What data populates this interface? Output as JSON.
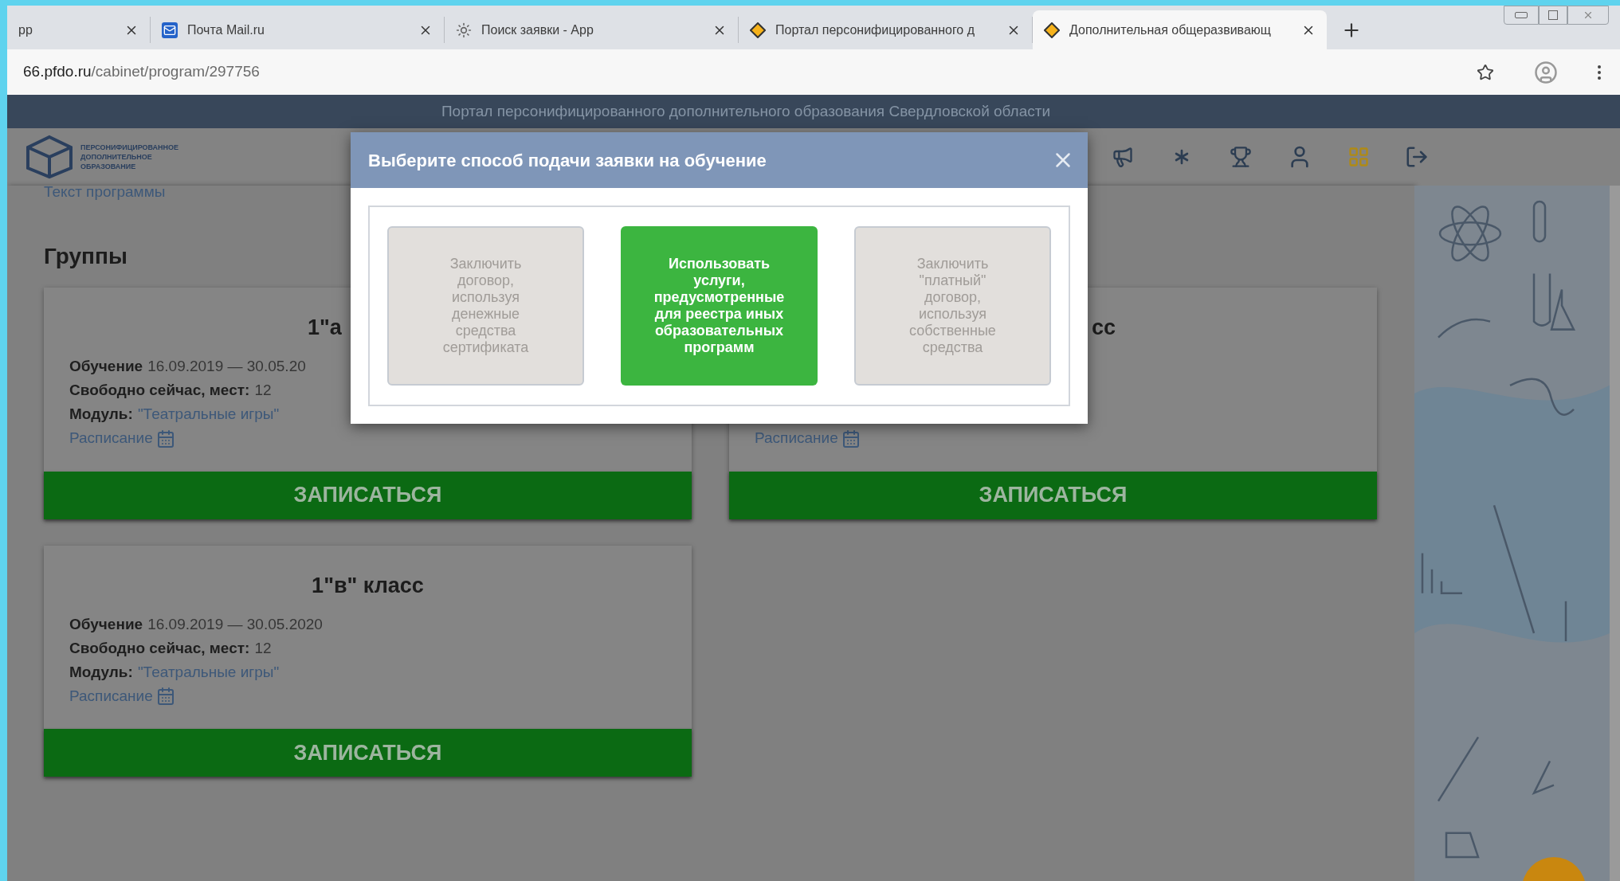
{
  "browser": {
    "tabs": [
      {
        "title": "pp",
        "kind": "plain",
        "selected": false
      },
      {
        "title": "Почта Mail.ru",
        "kind": "mail",
        "selected": false
      },
      {
        "title": "Поиск заявки - App",
        "kind": "sun",
        "selected": false
      },
      {
        "title": "Портал персонифицированного д",
        "kind": "diamond",
        "selected": false
      },
      {
        "title": "Дополнительная общеразвивающ",
        "kind": "diamond",
        "selected": true
      }
    ],
    "address": {
      "host": "66.pfdo.ru",
      "path": "/cabinet/program/297756"
    }
  },
  "site": {
    "banner": "Портал персонифицированного дополнительного образования Свердловской области",
    "logo_lines": [
      "ПЕРСОНИФИЦИРОВАННОЕ",
      "ДОПОЛНИТЕЛЬНОЕ",
      "ОБРАЗОВАНИЕ"
    ]
  },
  "page": {
    "link": "Текст программы",
    "heading": "Группы",
    "groups": [
      {
        "title": "1\"а",
        "fields": [
          {
            "label": "Обучение",
            "value": "16.09.2019 — 30.05.20",
            "kind": "text"
          },
          {
            "label": "Свободно сейчас, мест:",
            "value": "12",
            "kind": "text"
          },
          {
            "label": "Модуль:",
            "value": "\"Театральные игры\"",
            "kind": "link"
          }
        ],
        "schedule": "Расписание",
        "button": "ЗАПИСАТЬСЯ"
      },
      {
        "title": "сс",
        "schedule": "Расписание",
        "button": "ЗАПИСАТЬСЯ"
      },
      {
        "title": "1\"в\" класс",
        "fields": [
          {
            "label": "Обучение",
            "value": "16.09.2019 — 30.05.2020",
            "kind": "text"
          },
          {
            "label": "Свободно сейчас, мест:",
            "value": "12",
            "kind": "text"
          },
          {
            "label": "Модуль:",
            "value": "\"Театральные игры\"",
            "kind": "link"
          }
        ],
        "schedule": "Расписание",
        "button": "ЗАПИСАТЬСЯ"
      }
    ]
  },
  "modal": {
    "title": "Выберите способ подачи заявки на обучение",
    "options": [
      {
        "label": "Заключить договор, используя денежные средства сертификата",
        "selected": false
      },
      {
        "label": "Использовать услуги, предусмотренные для реестра иных образовательных программ",
        "selected": true
      },
      {
        "label": "Заключить \"платный\" договор, используя собственные средства",
        "selected": false
      }
    ]
  }
}
